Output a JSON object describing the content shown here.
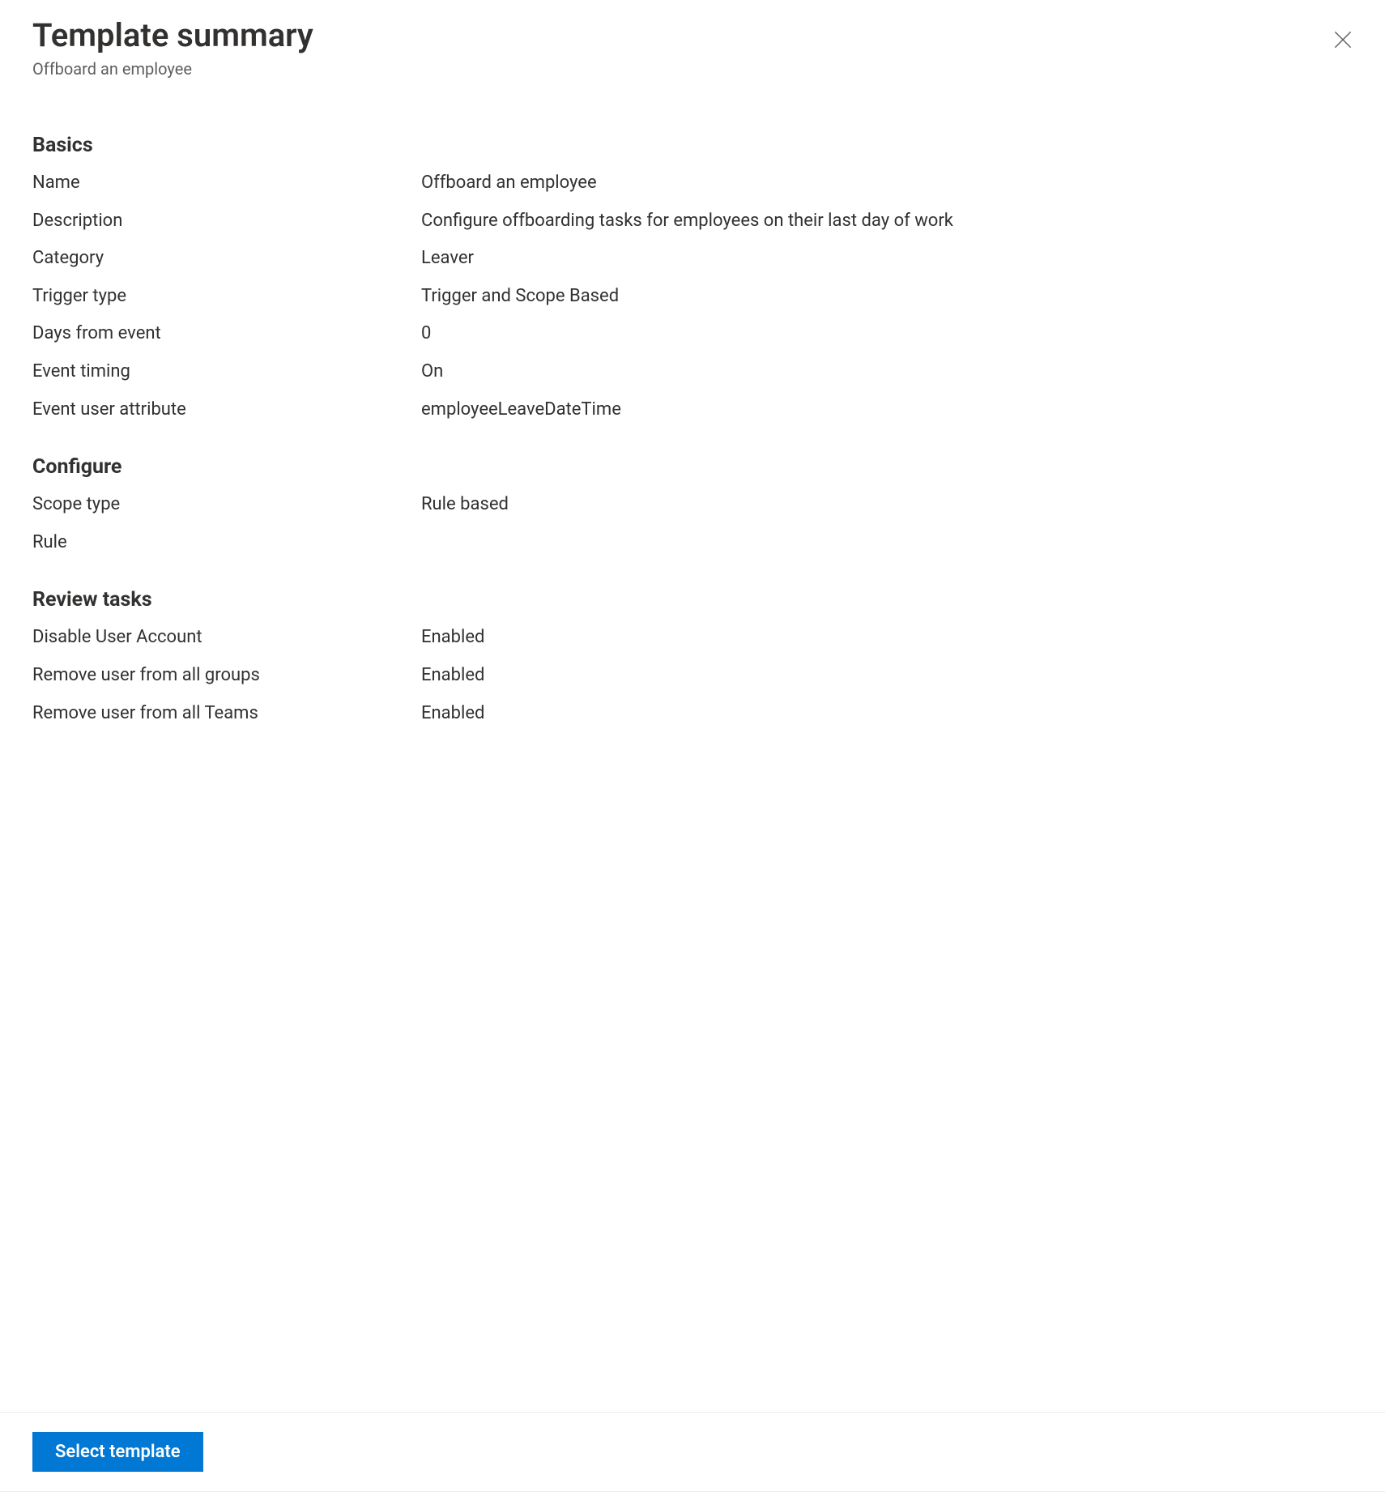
{
  "header": {
    "title": "Template summary",
    "subtitle": "Offboard an employee"
  },
  "sections": {
    "basics": {
      "heading": "Basics",
      "rows": {
        "name": {
          "label": "Name",
          "value": "Offboard an employee"
        },
        "description": {
          "label": "Description",
          "value": "Configure offboarding tasks for employees on their last day of work"
        },
        "category": {
          "label": "Category",
          "value": "Leaver"
        },
        "trigger_type": {
          "label": "Trigger type",
          "value": "Trigger and Scope Based"
        },
        "days_from_event": {
          "label": "Days from event",
          "value": "0"
        },
        "event_timing": {
          "label": "Event timing",
          "value": "On"
        },
        "event_user_attr": {
          "label": "Event user attribute",
          "value": "employeeLeaveDateTime"
        }
      }
    },
    "configure": {
      "heading": "Configure",
      "rows": {
        "scope_type": {
          "label": "Scope type",
          "value": "Rule based"
        },
        "rule": {
          "label": "Rule",
          "value": ""
        }
      }
    },
    "review_tasks": {
      "heading": "Review tasks",
      "rows": {
        "disable_user": {
          "label": "Disable User Account",
          "value": "Enabled"
        },
        "remove_groups": {
          "label": "Remove user from all groups",
          "value": "Enabled"
        },
        "remove_teams": {
          "label": "Remove user from all Teams",
          "value": "Enabled"
        }
      }
    }
  },
  "footer": {
    "select_template_label": "Select template"
  }
}
